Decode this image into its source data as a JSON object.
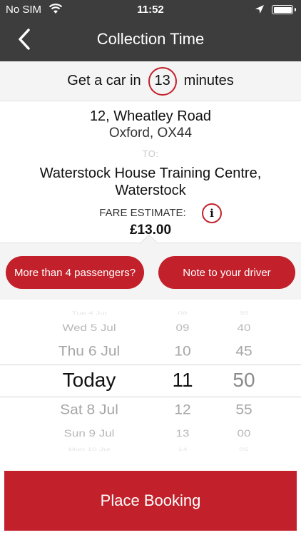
{
  "status_bar": {
    "carrier": "No SIM",
    "time": "11:52"
  },
  "nav": {
    "title": "Collection Time",
    "back_icon": "chevron-left-icon"
  },
  "eta": {
    "prefix": "Get a car in",
    "minutes": "13",
    "suffix": "minutes"
  },
  "pickup": {
    "line1": "12, Wheatley Road",
    "line2": "Oxford, OX44"
  },
  "to_label": "TO:",
  "destination": {
    "line1": "Waterstock House Training Centre,",
    "line2": "Waterstock"
  },
  "fare": {
    "label": "FARE ESTIMATE:",
    "info_icon": "i",
    "value": "£13.00"
  },
  "buttons": {
    "passengers": "More than 4 passengers?",
    "note": "Note to your driver"
  },
  "picker": {
    "days": [
      "Tue 4 Jul",
      "Wed 5 Jul",
      "Thu 6 Jul",
      "Today",
      "Sat 8 Jul",
      "Sun 9 Jul",
      "Mon 10 Jul"
    ],
    "hours": [
      "08",
      "09",
      "10",
      "11",
      "12",
      "13",
      "14"
    ],
    "minutes": [
      "35",
      "40",
      "45",
      "50",
      "55",
      "00",
      "05"
    ],
    "selected_index": 3
  },
  "place_booking": "Place Booking",
  "colors": {
    "accent": "#c2202a",
    "header": "#3d3d3d"
  }
}
